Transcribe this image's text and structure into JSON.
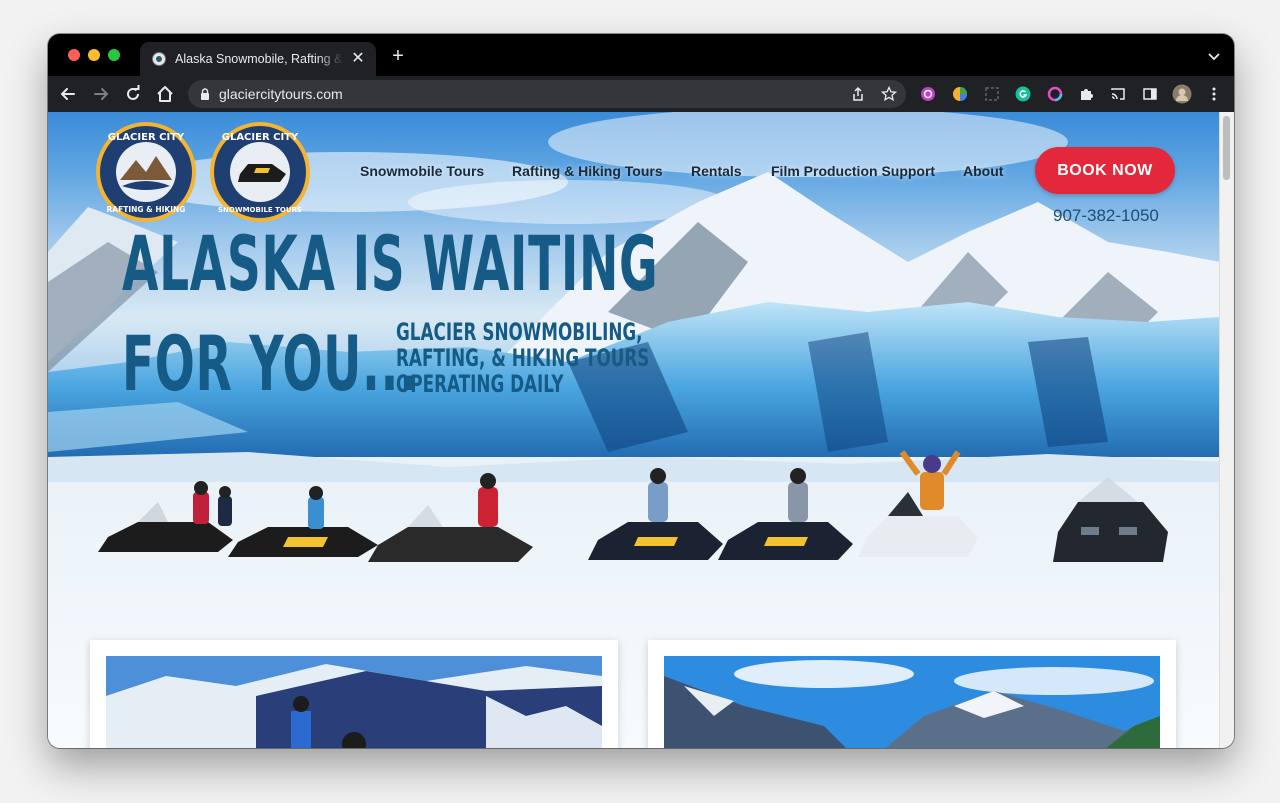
{
  "browser": {
    "tab_title": "Alaska Snowmobile, Rafting & Hiking Tours",
    "url": "glaciercitytours.com"
  },
  "site": {
    "logos": [
      {
        "name": "Glacier City Rafting & Hiking",
        "top_text": "GLACIER CITY",
        "bottom_text": "RAFTING & HIKING"
      },
      {
        "name": "Glacier City Snowmobile Tours",
        "top_text": "GLACIER CITY",
        "bottom_text": "SNOWMOBILE TOURS"
      }
    ],
    "nav": {
      "items": [
        {
          "label": "Snowmobile Tours"
        },
        {
          "label": "Rafting & Hiking Tours"
        },
        {
          "label": "Rentals"
        },
        {
          "label": "Film Production Support"
        },
        {
          "label": "About"
        }
      ],
      "book_now": "BOOK NOW",
      "phone": "907-382-1050"
    },
    "hero": {
      "title_line1": "ALASKA IS WAITING",
      "title_line2": "FOR YOU...",
      "subtitle_line1": "GLACIER SNOWMOBILING,",
      "subtitle_line2": "RAFTING, & HIKING TOURS",
      "subtitle_line3": "OPERATING DAILY"
    }
  },
  "colors": {
    "brand_red": "#e3283c",
    "title_blue": "#165b86",
    "browser_bg": "#202124"
  }
}
